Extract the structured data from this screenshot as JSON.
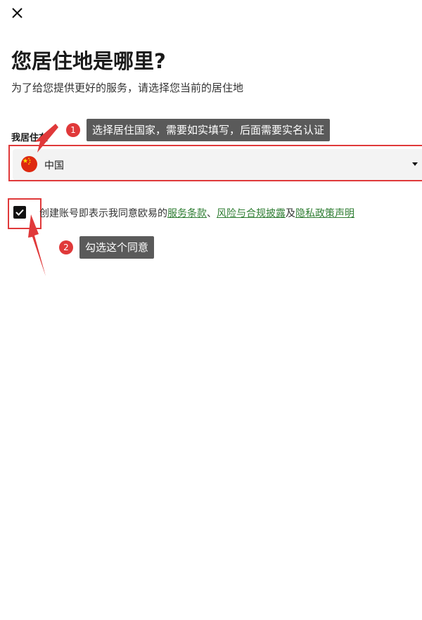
{
  "page": {
    "title": "您居住地是哪里?",
    "subtitle": "为了给您提供更好的服务，请选择您当前的居住地"
  },
  "residence": {
    "label": "我居住在",
    "selected_country": "中国"
  },
  "agreement": {
    "prefix": "创建账号即表示我同意欧易的",
    "link_terms": "服务条款",
    "sep1": "、",
    "link_risk": "风险与合规披露",
    "sep2": "及",
    "link_privacy": "隐私政策声明",
    "checked": true
  },
  "annotations": {
    "step1_number": "1",
    "step1_text": "选择居住国家，需要如实填写，后面需要实名认证",
    "step2_number": "2",
    "step2_text": "勾选这个同意"
  },
  "colors": {
    "annotation_red": "#e0393a",
    "tooltip_bg": "#5a5a5a",
    "link_green": "#2e7d32",
    "select_bg": "#f3f3f3"
  },
  "icons": {
    "close": "close-icon",
    "flag": "china-flag-icon",
    "caret": "caret-down-icon",
    "check": "checkmark-icon"
  }
}
